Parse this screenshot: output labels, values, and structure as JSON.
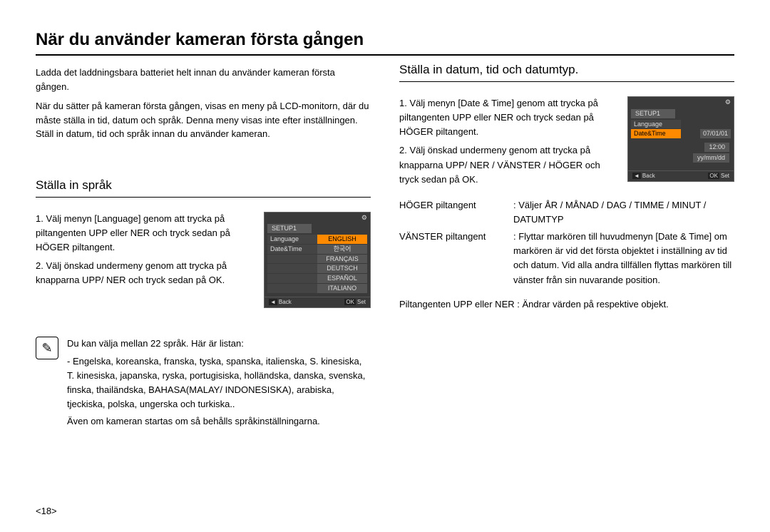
{
  "title": "När du använder kameran första gången",
  "intro": {
    "p1": "Ladda det laddningsbara batteriet helt innan du använder kameran första gången.",
    "p2": "När du sätter på kameran första gången, visas en meny på LCD-monitorn, där du måste ställa in tid, datum och språk. Denna meny visas inte efter inställningen. Ställ in datum, tid och språk innan du använder kameran."
  },
  "left": {
    "heading": "Ställa in språk",
    "step1": "1. Välj menyn [Language] genom att trycka på piltangenten UPP eller NER och tryck sedan på HÖGER piltangent.",
    "step2": "2. Välj önskad undermeny genom att trycka på knapparna UPP/ NER och tryck sedan på OK.",
    "note1_lead": "Du kan välja mellan 22 språk. Här är listan:",
    "note1_body": "- Engelska, koreanska, franska, tyska, spanska, italienska, S. kinesiska, T. kinesiska, japanska, ryska, portugisiska, holländska, danska, svenska, finska, thailändska, BAHASA(MALAY/ INDONESISKA), arabiska, tjeckiska, polska, ungerska och turkiska..",
    "note2": "Även om kameran startas om så behålls språkinställningarna."
  },
  "right": {
    "heading": "Ställa in datum, tid och datumtyp.",
    "step1": "1. Välj menyn [Date & Time] genom att trycka på piltangenten UPP eller NER och tryck sedan på HÖGER piltangent.",
    "step2": "2. Välj önskad undermeny genom att trycka på knapparna UPP/ NER / VÄNSTER / HÖGER och tryck sedan på OK.",
    "defs": [
      {
        "term": "HÖGER piltangent",
        "def": ": Väljer ÅR / MÅNAD / DAG / TIMME / MINUT / DATUMTYP"
      },
      {
        "term": "VÄNSTER piltangent",
        "def": ": Flyttar markören till huvudmenyn [Date & Time] om markören är vid det första objektet i inställning av tid och datum. Vid alla andra tillfällen flyttas markören till vänster från sin nuvarande position."
      }
    ],
    "footer": "Piltangenten UPP eller NER : Ändrar värden på respektive objekt."
  },
  "lcd_lang": {
    "setup": "SETUP1",
    "items_left": [
      "Language",
      "Date&Time"
    ],
    "items_right": [
      "ENGLISH",
      "한국어",
      "FRANÇAIS",
      "DEUTSCH",
      "ESPAÑOL",
      "ITALIANO"
    ],
    "back": "Back",
    "ok": "OK",
    "set": "Set"
  },
  "lcd_date": {
    "setup": "SETUP1",
    "items_left": [
      "Language",
      "Date&Time"
    ],
    "values": [
      "07/01/01",
      "12:00",
      "yy/mm/dd"
    ],
    "back": "Back",
    "ok": "OK",
    "set": "Set"
  },
  "page_number": "<18>",
  "icons": {
    "note": "✎",
    "gear": "⚙",
    "left": "◄"
  }
}
